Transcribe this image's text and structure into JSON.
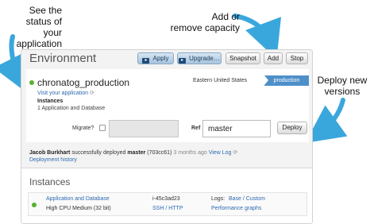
{
  "annotations": {
    "status": "See the\nstatus of your\napplication",
    "capacity": "Add or\nremove capacity",
    "deploy": "Deploy new\nversions"
  },
  "header": {
    "title": "Environment",
    "buttons": {
      "apply": "Apply",
      "upgrade": "Upgrade…",
      "snapshot": "Snapshot",
      "add": "Add",
      "stop": "Stop"
    }
  },
  "app": {
    "name": "chronatog_production",
    "visit_link": "Visit your application",
    "instances_heading": "Instances",
    "instances_text": "1 Application and Database",
    "region": "Eastern United States",
    "environment_tag": "production",
    "status_color": "#5ab130"
  },
  "deploy_form": {
    "migrate_label": "Migrate?",
    "migrate_checked": false,
    "ref_label": "Ref",
    "ref_value": "master",
    "deploy_label": "Deploy"
  },
  "last_deploy": {
    "user": "Jacob Burkhart",
    "text": "successfully deployed",
    "branch": "master",
    "commit": "(703cc61)",
    "time": "3 months ago",
    "log_link": "View Log",
    "history_link": "Deployment history"
  },
  "instances": {
    "title": "Instances",
    "rows": [
      {
        "role": "Application and Database",
        "size": "High CPU Medium (32 bit)",
        "id": "i-45c3ad23",
        "access": "SSH / HTTP",
        "logs_label": "Logs:",
        "logs_links": "Base / Custom",
        "graphs": "Performance graphs",
        "status_color": "#5ab130"
      }
    ]
  },
  "colors": {
    "accent": "#2d6ab0",
    "arrow": "#3aa7dc",
    "tag": "#4f8fc9"
  }
}
